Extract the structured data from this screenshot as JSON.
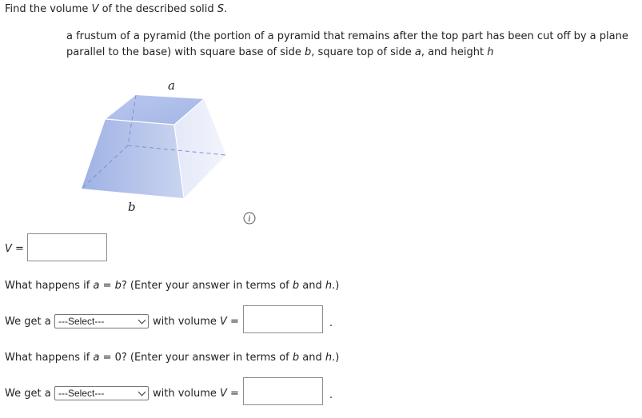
{
  "prompt": {
    "prefix": "Find the volume ",
    "var_v": "V",
    "middle": " of the described solid ",
    "var_s": "S",
    "suffix": "."
  },
  "description": {
    "part1": "a frustum of a pyramid (the portion of a pyramid that remains after the top part has been cut off by a plane parallel to the base) with square base of side ",
    "b": "b",
    "part2": ", square top of side ",
    "a": "a",
    "part3": ", and height ",
    "h": "h"
  },
  "figure": {
    "top_label": "a",
    "bottom_label": "b",
    "info_icon": "info-icon"
  },
  "volume_answer": {
    "var": "V",
    "eq": " =",
    "value": ""
  },
  "question1": {
    "prefix": "What happens if ",
    "a": "a",
    "op": " = ",
    "b": "b",
    "suffix1": "? (Enter your answer in terms of ",
    "b2": "b",
    "and": " and ",
    "h": "h",
    "suffix2": ".)",
    "we_get": "We get a",
    "select_value": "---Select---",
    "with_volume": "with volume ",
    "var": "V",
    "eq": " =",
    "period": "."
  },
  "question2": {
    "prefix": "What happens if ",
    "a": "a",
    "op": " = 0? (Enter your answer in terms of ",
    "b": "b",
    "and": " and ",
    "h": "h",
    "suffix": ".)",
    "we_get": "We get a",
    "select_value": "---Select---",
    "with_volume": "with volume ",
    "var": "V",
    "eq": " =",
    "period": "."
  }
}
